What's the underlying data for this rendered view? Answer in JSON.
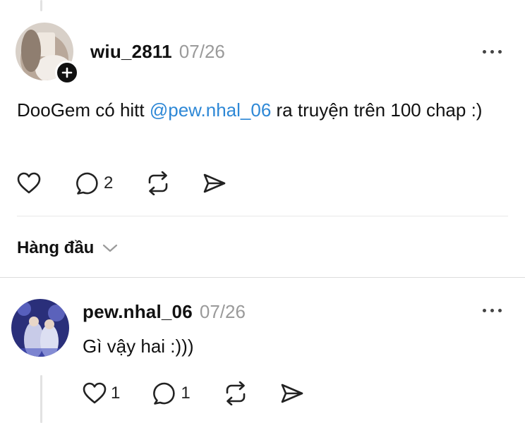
{
  "post": {
    "username": "wiu_2811",
    "timestamp": "07/26",
    "text_before": "DooGem có hitt ",
    "mention": "@pew.nhal_06",
    "text_after": "  ra truyện trên 100 chap :)",
    "reply_count": "2"
  },
  "sort": {
    "label": "Hàng đầu"
  },
  "reply": {
    "username": "pew.nhal_06",
    "timestamp": "07/26",
    "text": "Gì vậy hai :)))",
    "like_count": "1",
    "reply_count": "1"
  },
  "icons": {
    "add": "plus-icon",
    "more": "more-icon",
    "like": "heart-icon",
    "comment": "comment-icon",
    "repost": "repost-icon",
    "share": "send-icon",
    "sort": "chevron-down-icon"
  },
  "colors": {
    "mention": "#2e88d6",
    "text": "#111111",
    "muted": "#9a9a9a",
    "background": "#ffffff"
  }
}
